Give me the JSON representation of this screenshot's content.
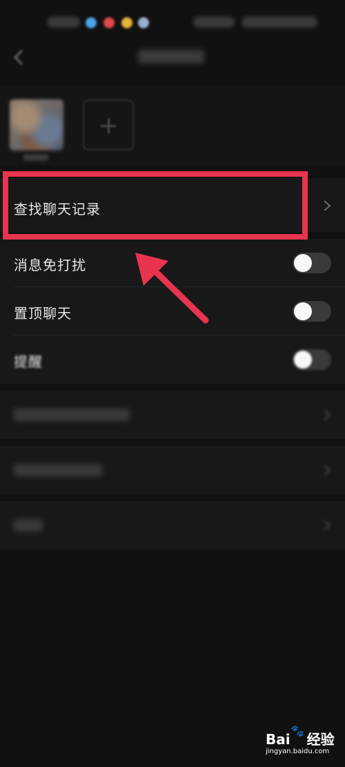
{
  "search_history": {
    "label": "查找聊天记录"
  },
  "settings": [
    {
      "label": "消息免打扰",
      "enabled": false
    },
    {
      "label": "置顶聊天",
      "enabled": false
    },
    {
      "label": "提醒",
      "enabled": false
    }
  ],
  "annotation": {
    "color": "#e8344e"
  },
  "watermark": {
    "brand": "Bai",
    "product": "经验",
    "url": "jingyan.baidu.com"
  }
}
